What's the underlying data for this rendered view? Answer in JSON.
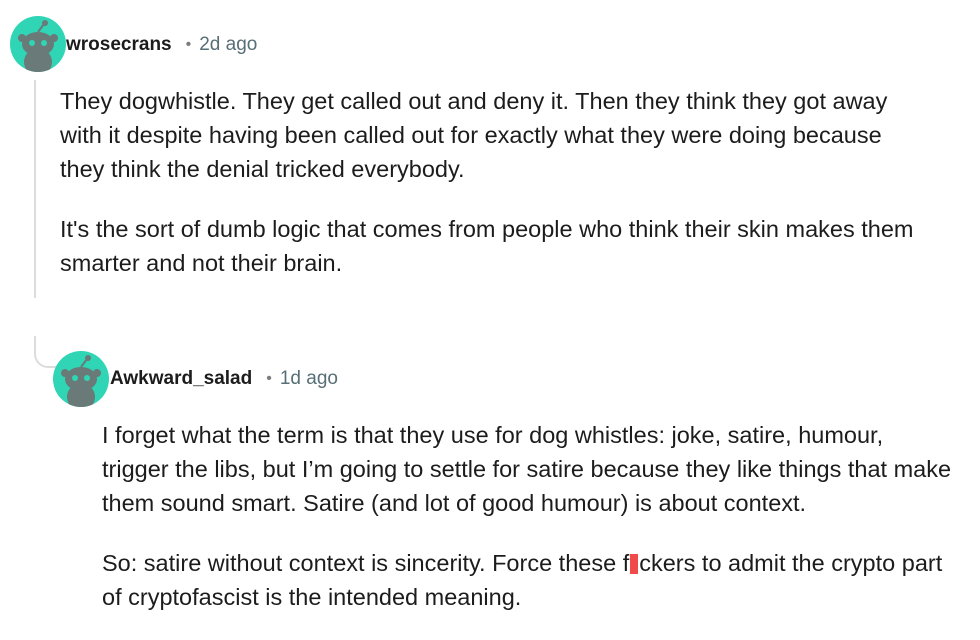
{
  "comments": [
    {
      "username": "wrosecrans",
      "separator": "•",
      "timestamp": "2d ago",
      "paragraphs": [
        "They dogwhistle. They get called out and deny it. Then they think they got away with it despite having been called out for exactly what they were doing because they think the denial tricked everybody.",
        "It's the sort of dumb logic that comes from people who think their skin makes them smarter and not their brain."
      ]
    },
    {
      "username": "Awkward_salad",
      "separator": "•",
      "timestamp": "1d ago",
      "paragraphs": [
        "I forget what the term is that they use for dog whistles: joke, satire, humour, trigger the libs, but I’m going to settle for satire because they like things that make them sound smart. Satire (and lot of good humour) is about context."
      ],
      "paragraph2_before": "So: satire without context is sincerity. Force these f",
      "paragraph2_after": "ckers to admit the crypto part of cryptofascist is the intended meaning."
    }
  ],
  "colors": {
    "avatar": "#2fd5b5",
    "thread_line": "#dcdcdc",
    "censor_mark": "#f04a4a"
  },
  "icons": {
    "avatar": "snoo-avatar-icon"
  }
}
